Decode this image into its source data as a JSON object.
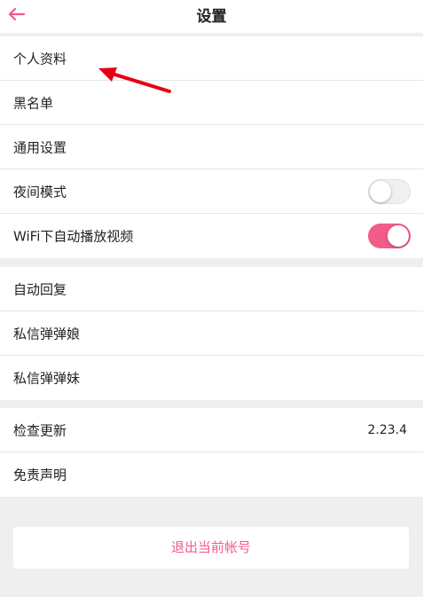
{
  "header": {
    "title": "设置",
    "back_icon": "arrow-left-icon"
  },
  "groups": [
    {
      "items": [
        {
          "label": "个人资料"
        },
        {
          "label": "黑名单"
        },
        {
          "label": "通用设置"
        },
        {
          "label": "夜间模式",
          "toggle": "off"
        },
        {
          "label": "WiFi下自动播放视频",
          "toggle": "on"
        }
      ]
    },
    {
      "items": [
        {
          "label": "自动回复"
        },
        {
          "label": "私信弹弹娘"
        },
        {
          "label": "私信弹弹妹"
        }
      ]
    },
    {
      "items": [
        {
          "label": "检查更新",
          "value": "2.23.4"
        },
        {
          "label": "免责声明"
        }
      ]
    }
  ],
  "logout_label": "退出当前帐号",
  "colors": {
    "accent": "#f25c88",
    "annotation": "#e60012",
    "background": "#efefef"
  }
}
